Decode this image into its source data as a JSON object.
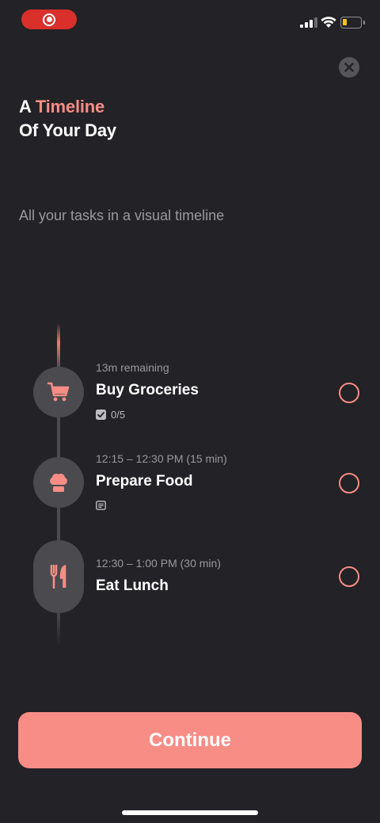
{
  "header": {
    "title_prefix": "A ",
    "title_accent": "Timeline",
    "title_line2": "Of Your Day",
    "subtitle": "All your tasks in a visual timeline"
  },
  "tasks": [
    {
      "icon": "shopping-cart-icon",
      "meta": "13m remaining",
      "title": "Buy Groceries",
      "subtasks": "0/5"
    },
    {
      "icon": "chef-hat-icon",
      "meta": "12:15 – 12:30 PM (15 min)",
      "title": "Prepare Food",
      "note": true
    },
    {
      "icon": "fork-knife-icon",
      "meta": "12:30 – 1:00 PM (30 min)",
      "title": "Eat Lunch"
    }
  ],
  "actions": {
    "continue_label": "Continue"
  },
  "colors": {
    "accent": "#f88d86",
    "background": "#232226",
    "icon_bg": "#4a4a4f",
    "recording": "#d9302c"
  }
}
